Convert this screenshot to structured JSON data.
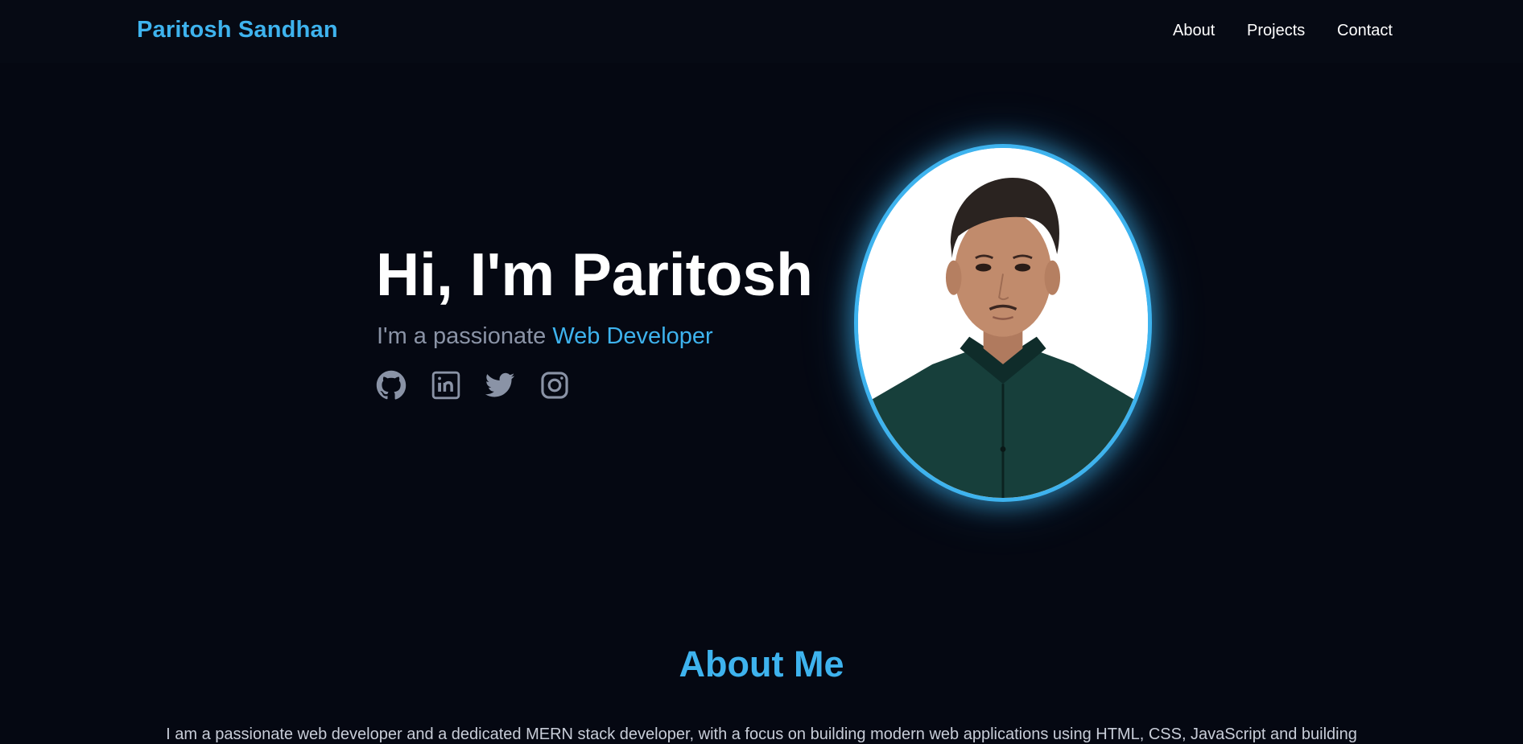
{
  "nav": {
    "brand": "Paritosh Sandhan",
    "links": [
      "About",
      "Projects",
      "Contact"
    ]
  },
  "hero": {
    "title": "Hi, I'm Paritosh",
    "subtitle_prefix": "I'm a passionate ",
    "subtitle_highlight": "Web Developer",
    "social_icons": [
      "github-icon",
      "linkedin-icon",
      "twitter-icon",
      "instagram-icon"
    ]
  },
  "about": {
    "title": "About Me",
    "text": "I am a passionate web developer and a dedicated MERN stack developer, with a focus on building modern web applications using HTML, CSS, JavaScript and building"
  },
  "colors": {
    "background": "#050812",
    "accent": "#3eb3ee",
    "muted": "#8a93a6",
    "text": "#ffffff"
  }
}
